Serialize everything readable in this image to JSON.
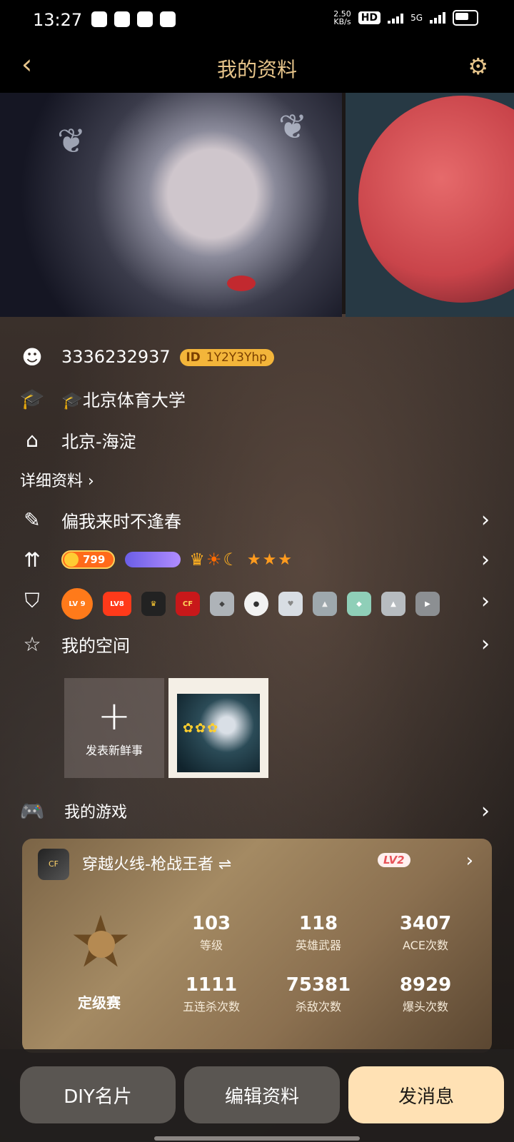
{
  "status_bar": {
    "time": "13:27",
    "net_rate": "2.50",
    "net_unit": "KB/s",
    "hd": "HD",
    "signal": "5G"
  },
  "header": {
    "title": "我的资料"
  },
  "profile": {
    "qq": "3336232937",
    "id_label": "ID",
    "id_value": "1Y2Y3Yhp",
    "school": "北京体育大学",
    "location": "北京-海淀",
    "detail_link": "详细资料 ›",
    "signature": "偏我来时不逢春"
  },
  "level_row": {
    "coin_value": "799"
  },
  "badges_row": {
    "lv9": "LV 9",
    "lv8": "LV8"
  },
  "space": {
    "label": "我的空间",
    "add_label": "发表新鲜事"
  },
  "games": {
    "label": "我的游戏",
    "card": {
      "name": "穿越火线-枪战王者 ⇌",
      "badge": "LV2",
      "rank_label": "定级赛",
      "stats": [
        {
          "value": "103",
          "label": "等级"
        },
        {
          "value": "118",
          "label": "英雄武器"
        },
        {
          "value": "3407",
          "label": "ACE次数"
        },
        {
          "value": "1111",
          "label": "五连杀次数"
        },
        {
          "value": "75381",
          "label": "杀敌次数"
        },
        {
          "value": "8929",
          "label": "爆头次数"
        }
      ]
    }
  },
  "actions": {
    "diy": "DIY名片",
    "edit": "编辑资料",
    "message": "发消息"
  },
  "colors": {
    "accent": "#e6c48a",
    "primary_button": "#ffe1b4"
  }
}
